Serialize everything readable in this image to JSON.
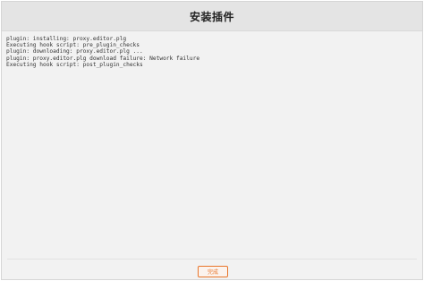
{
  "dialog": {
    "title": "安装插件",
    "log_lines": [
      "plugin: installing: proxy.editor.plg",
      "Executing hook script: pre_plugin_checks",
      "plugin: downloading: proxy.editor.plg ...",
      "plugin: proxy.editor.plg download failure: Network failure",
      "Executing hook script: post_plugin_checks"
    ],
    "finish_label": "完成"
  },
  "colors": {
    "accent": "#e8752a",
    "title_bar": "#e4e4e4",
    "panel": "#f2f2f2"
  }
}
